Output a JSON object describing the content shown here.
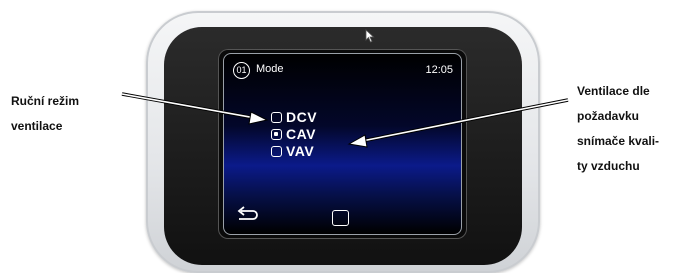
{
  "screen": {
    "mode_number": "01",
    "mode_title": "Mode",
    "time": "12:05",
    "options": [
      {
        "label": "DCV",
        "selected": false
      },
      {
        "label": "CAV",
        "selected": true
      },
      {
        "label": "VAV",
        "selected": false
      }
    ]
  },
  "annotations": {
    "left_line1": "Ruční režim",
    "left_line2": "ventilace",
    "right_line1": "Ventilace dle",
    "right_line2": "požadavku",
    "right_line3": "snímače kvali-",
    "right_line4": "ty vzduchu"
  },
  "icons": {
    "back": "back-arrow-icon",
    "home": "home-square-icon",
    "cursor": "mouse-pointer-icon"
  },
  "colors": {
    "screen_blue": "#0b1a8a",
    "bezel": "#1a1a1a",
    "housing": "#e6e8eb"
  }
}
